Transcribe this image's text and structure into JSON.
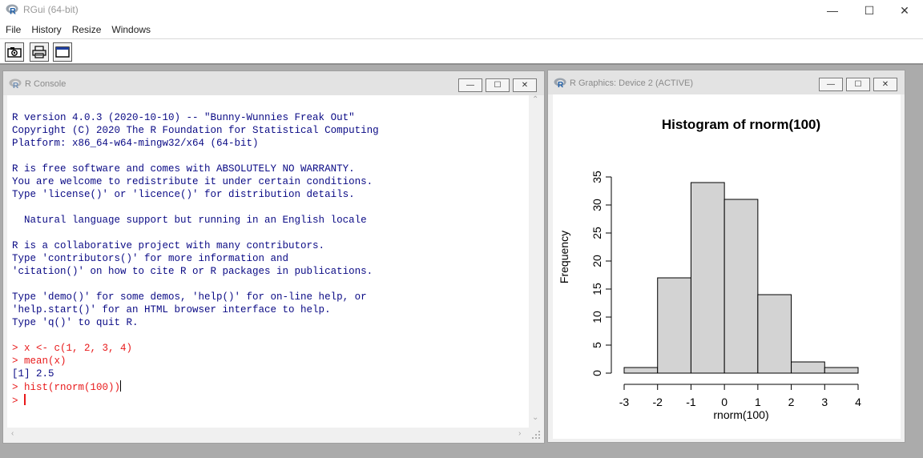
{
  "app": {
    "title": "RGui (64-bit)"
  },
  "window_controls": {
    "minimize": "—",
    "maximize": "☐",
    "close": "✕"
  },
  "menu": [
    "File",
    "History",
    "Resize",
    "Windows"
  ],
  "toolbar": {
    "icons": [
      "camera-icon",
      "printer-icon",
      "window-icon"
    ]
  },
  "console": {
    "title": "R Console",
    "lines": [
      {
        "type": "out",
        "text": "R version 4.0.3 (2020-10-10) -- \"Bunny-Wunnies Freak Out\""
      },
      {
        "type": "out",
        "text": "Copyright (C) 2020 The R Foundation for Statistical Computing"
      },
      {
        "type": "out",
        "text": "Platform: x86_64-w64-mingw32/x64 (64-bit)"
      },
      {
        "type": "blank",
        "text": ""
      },
      {
        "type": "out",
        "text": "R is free software and comes with ABSOLUTELY NO WARRANTY."
      },
      {
        "type": "out",
        "text": "You are welcome to redistribute it under certain conditions."
      },
      {
        "type": "out",
        "text": "Type 'license()' or 'licence()' for distribution details."
      },
      {
        "type": "blank",
        "text": ""
      },
      {
        "type": "out",
        "text": "  Natural language support but running in an English locale"
      },
      {
        "type": "blank",
        "text": ""
      },
      {
        "type": "out",
        "text": "R is a collaborative project with many contributors."
      },
      {
        "type": "out",
        "text": "Type 'contributors()' for more information and"
      },
      {
        "type": "out",
        "text": "'citation()' on how to cite R or R packages in publications."
      },
      {
        "type": "blank",
        "text": ""
      },
      {
        "type": "out",
        "text": "Type 'demo()' for some demos, 'help()' for on-line help, or"
      },
      {
        "type": "out",
        "text": "'help.start()' for an HTML browser interface to help."
      },
      {
        "type": "out",
        "text": "Type 'q()' to quit R."
      },
      {
        "type": "blank",
        "text": ""
      },
      {
        "type": "in",
        "text": "> x <- c(1, 2, 3, 4)"
      },
      {
        "type": "in",
        "text": "> mean(x)"
      },
      {
        "type": "out",
        "text": "[1] 2.5"
      },
      {
        "type": "in",
        "text": "> hist(rnorm(100))",
        "caret": "black"
      },
      {
        "type": "in",
        "text": "> ",
        "caret": "red"
      }
    ]
  },
  "graphics": {
    "title": "R Graphics: Device 2 (ACTIVE)"
  },
  "colors": {
    "output_text": "#0a0a85",
    "input_text": "#e8191a",
    "bar_fill": "#d3d3d3"
  },
  "chart_data": {
    "type": "bar",
    "title": "Histogram of rnorm(100)",
    "xlabel": "rnorm(100)",
    "ylabel": "Frequency",
    "bin_edges": [
      -3,
      -2,
      -1,
      0,
      1,
      2,
      3,
      4
    ],
    "values": [
      1,
      17,
      34,
      31,
      14,
      2,
      1
    ],
    "xlim": [
      -3,
      4
    ],
    "ylim": [
      0,
      35
    ],
    "x_ticks": [
      -3,
      -2,
      -1,
      0,
      1,
      2,
      3,
      4
    ],
    "y_ticks": [
      0,
      5,
      10,
      15,
      20,
      25,
      30,
      35
    ],
    "grid": false
  }
}
